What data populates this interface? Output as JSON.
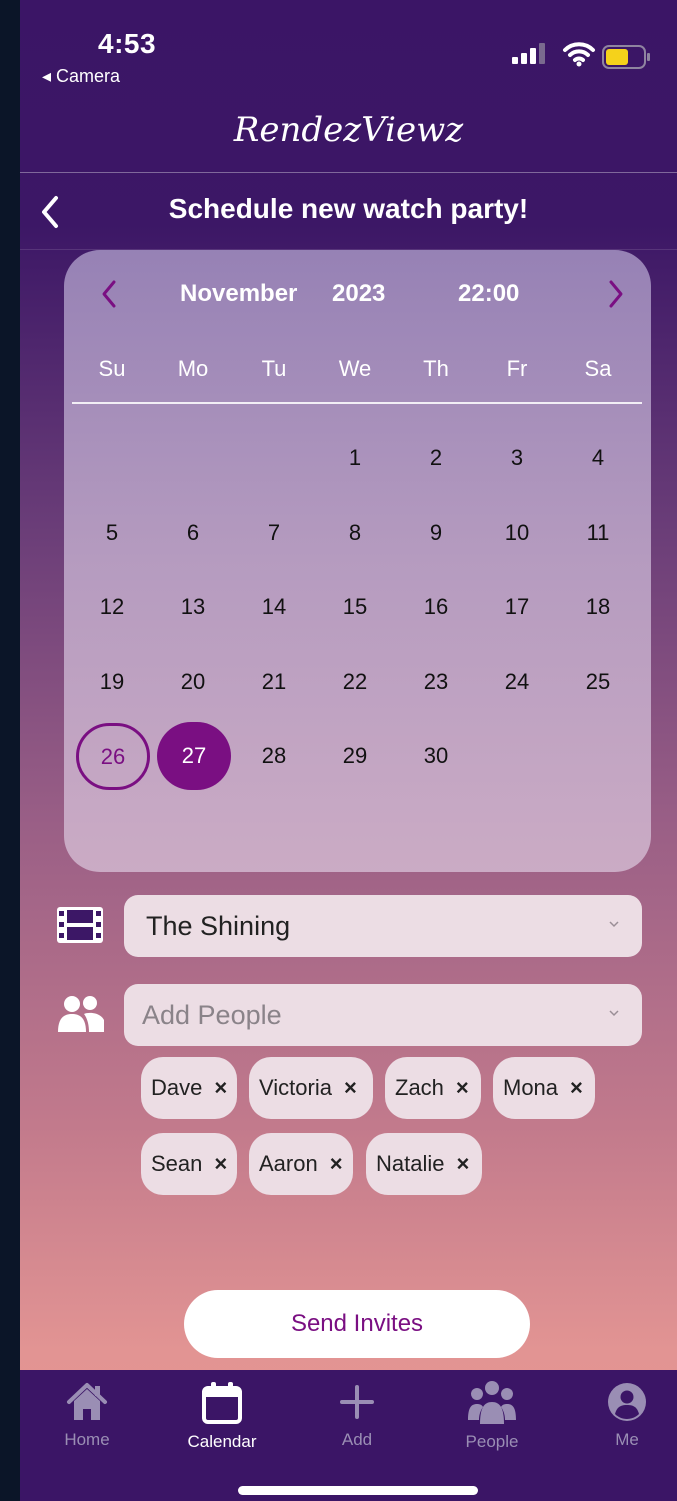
{
  "status_bar": {
    "time": "4:53",
    "back_app": "◂ Camera"
  },
  "app": {
    "logo": "RendezViewz"
  },
  "header": {
    "title": "Schedule new watch party!"
  },
  "calendar": {
    "month": "November",
    "year": "2023",
    "time": "22:00",
    "weekdays": [
      "Su",
      "Mo",
      "Tu",
      "We",
      "Th",
      "Fr",
      "Sa"
    ],
    "weeks": [
      [
        "",
        "",
        "",
        "1",
        "2",
        "3",
        "4"
      ],
      [
        "5",
        "6",
        "7",
        "8",
        "9",
        "10",
        "11"
      ],
      [
        "12",
        "13",
        "14",
        "15",
        "16",
        "17",
        "18"
      ],
      [
        "19",
        "20",
        "21",
        "22",
        "23",
        "24",
        "25"
      ],
      [
        "26",
        "27",
        "28",
        "29",
        "30",
        "",
        ""
      ]
    ],
    "today": "26",
    "selected": "27"
  },
  "form": {
    "movie": {
      "value": "The Shining"
    },
    "people": {
      "placeholder": "Add People",
      "chips": [
        "Dave",
        "Victoria",
        "Zach",
        "Mona",
        "Sean",
        "Aaron",
        "Natalie"
      ],
      "remove_glyph": "×"
    }
  },
  "actions": {
    "send_label": "Send Invites"
  },
  "tabbar": {
    "tabs": [
      {
        "label": "Home",
        "icon": "home-icon"
      },
      {
        "label": "Calendar",
        "icon": "calendar-icon"
      },
      {
        "label": "Add",
        "icon": "plus-icon"
      },
      {
        "label": "People",
        "icon": "people-icon"
      },
      {
        "label": "Me",
        "icon": "user-icon"
      }
    ],
    "active": "Calendar"
  },
  "colors": {
    "accent": "#7a0f82",
    "header_bg": "#3b1566",
    "field_bg": "#ecdde4",
    "battery": "#f5d21b"
  }
}
